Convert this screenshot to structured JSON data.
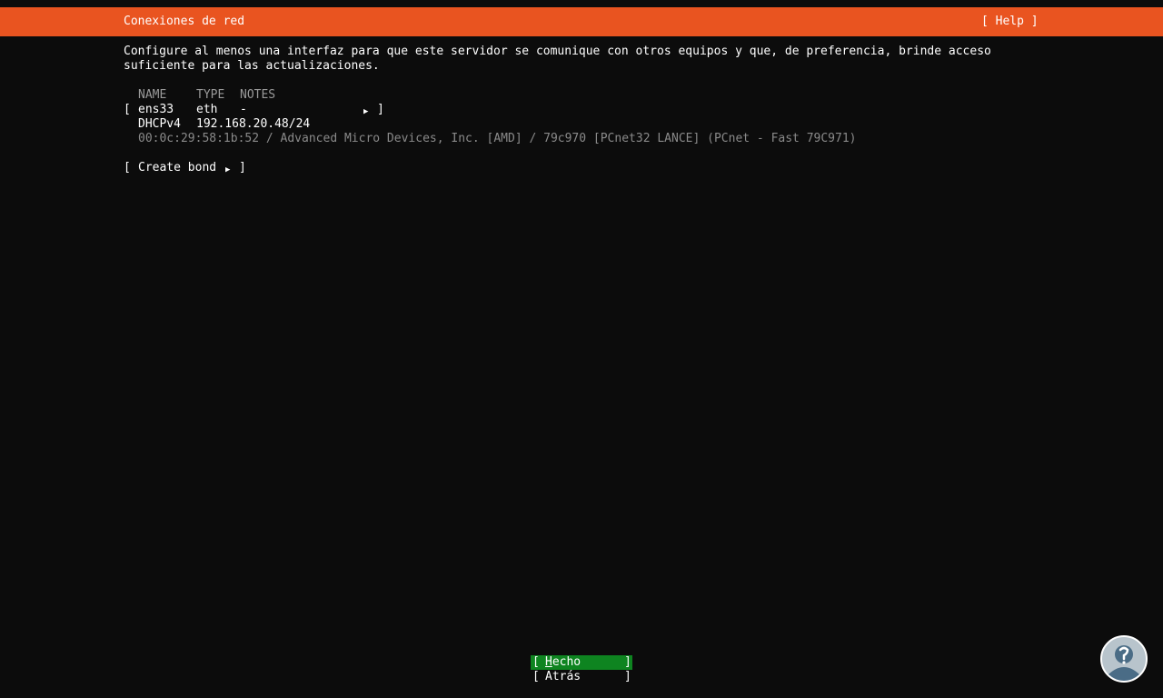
{
  "header": {
    "title": "Conexiones de red",
    "help_label": "[ Help ]"
  },
  "description": "Configure al menos una interfaz para que este servidor se comunique con otros equipos y que, de preferencia, brinde acceso suficiente para las actualizaciones.",
  "table": {
    "columns": [
      "NAME",
      "TYPE",
      "NOTES"
    ],
    "interfaces": [
      {
        "open_bracket": "[",
        "name": "ens33",
        "type": "eth",
        "notes": "-",
        "arrow": "▶",
        "close_bracket": "]",
        "address_method": "DHCPv4",
        "address": "192.168.20.48/24",
        "hw_info": "00:0c:29:58:1b:52 / Advanced Micro Devices, Inc. [AMD] / 79c970 [PCnet32 LANCE] (PCnet - Fast 79C971)"
      }
    ]
  },
  "create_bond": {
    "open_bracket": "[",
    "label": "Create bond",
    "arrow": "▶",
    "close_bracket": "]"
  },
  "buttons": {
    "done": {
      "open": "[",
      "accel": "H",
      "rest": "echo",
      "close": "]"
    },
    "back": {
      "open": "[",
      "label": "Atrás",
      "close": "]"
    }
  },
  "colors": {
    "header_bg": "#e95420",
    "selected_button_bg": "#0e8420",
    "background": "#0c0c0c"
  },
  "icons": {
    "watermark": "person-circle-logo-icon"
  }
}
